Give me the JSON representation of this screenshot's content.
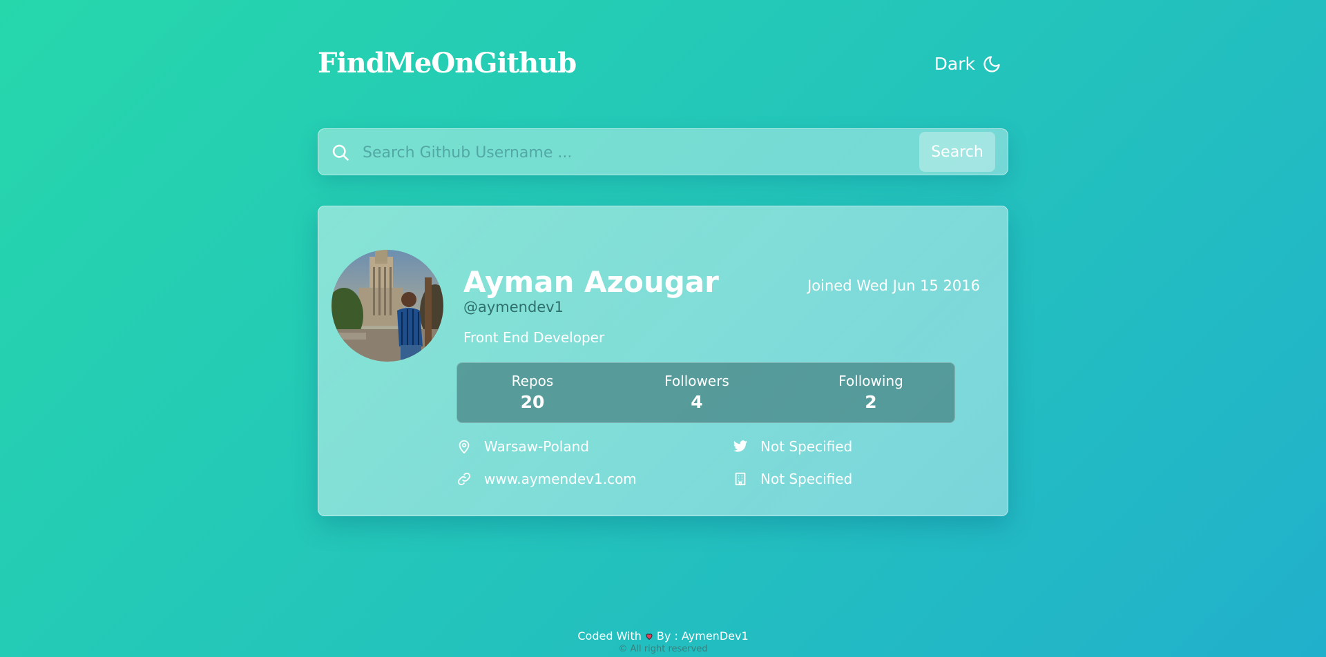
{
  "header": {
    "brand": "FindMeOnGithub",
    "theme_toggle_label": "Dark",
    "theme_icon": "moon-icon"
  },
  "search": {
    "placeholder": "Search Github Username ...",
    "value": "",
    "button_label": "Search",
    "icon": "search-icon"
  },
  "profile": {
    "name": "Ayman Azougar",
    "handle": "@aymendev1",
    "joined": "Joined Wed Jun 15 2016",
    "bio": "Front End Developer",
    "stats": [
      {
        "label": "Repos",
        "value": "20"
      },
      {
        "label": "Followers",
        "value": "4"
      },
      {
        "label": "Following",
        "value": "2"
      }
    ],
    "location": "Warsaw-Poland",
    "twitter": "Not Specified",
    "website": "www.aymendev1.com",
    "company": "Not Specified"
  },
  "footer": {
    "credit_prefix": "Coded With",
    "credit_suffix": "By : AymenDev1",
    "copyright": "© All right reserved"
  },
  "colors": {
    "gradient_start": "#26d7ab",
    "gradient_end": "#21b0cc",
    "stats_panel": "#468282"
  }
}
